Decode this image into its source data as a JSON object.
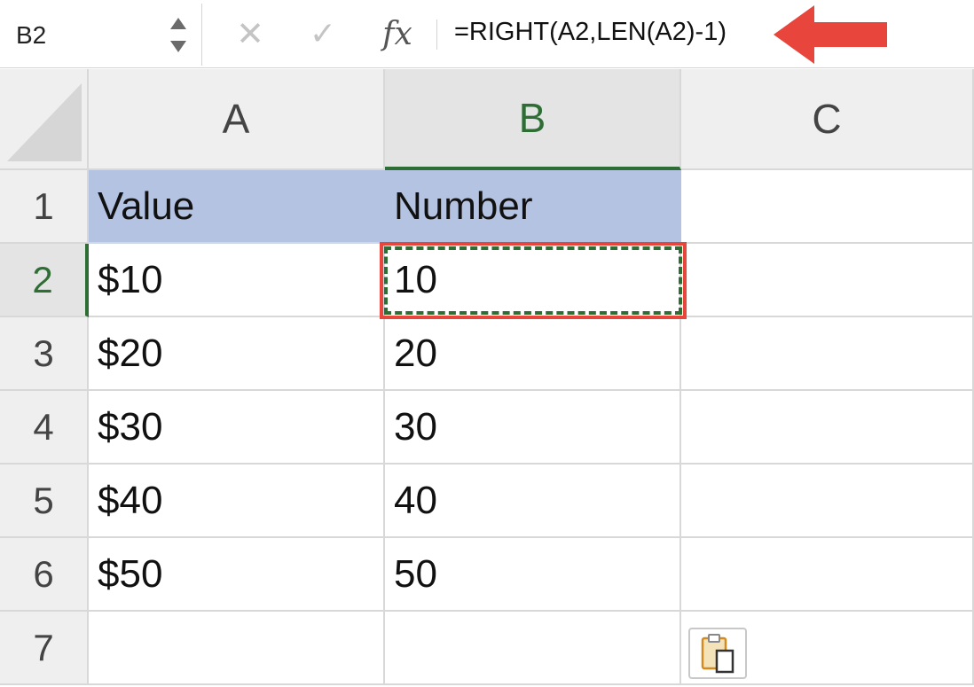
{
  "formula_bar": {
    "name_box": "B2",
    "formula": "=RIGHT(A2,LEN(A2)-1)",
    "icons": {
      "cancel": "close-icon",
      "enter": "checkmark-icon",
      "function": "fx-icon",
      "annotation": "red-arrow-icon"
    }
  },
  "columns": [
    "A",
    "B",
    "C"
  ],
  "rows": [
    "1",
    "2",
    "3",
    "4",
    "5",
    "6",
    "7"
  ],
  "cells": {
    "A": [
      "Value",
      "$10",
      "$20",
      "$30",
      "$40",
      "$50",
      ""
    ],
    "B": [
      "Number",
      "10",
      "20",
      "30",
      "40",
      "50",
      ""
    ],
    "C": [
      "",
      "",
      "",
      "",
      "",
      "",
      ""
    ]
  },
  "selected_cell": "B2",
  "colors": {
    "header_fill": "#b5c3e3",
    "selection_green": "#2e6e35",
    "annotation_red": "#e8453c"
  },
  "paste_options_icon": "clipboard-icon"
}
